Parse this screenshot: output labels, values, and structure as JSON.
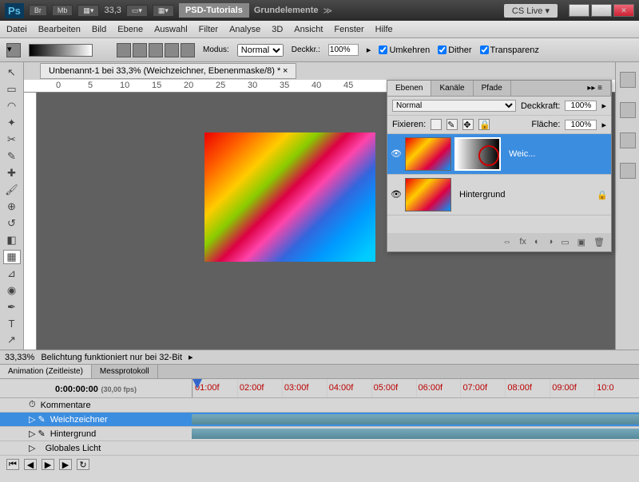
{
  "title": {
    "br": "Br",
    "mb": "Mb",
    "zoom": "33,3",
    "tag": "PSD-Tutorials",
    "sub": "Grundelemente",
    "cslive": "CS Live"
  },
  "menu": [
    "Datei",
    "Bearbeiten",
    "Bild",
    "Ebene",
    "Auswahl",
    "Filter",
    "Analyse",
    "3D",
    "Ansicht",
    "Fenster",
    "Hilfe"
  ],
  "options": {
    "modus": "Modus:",
    "modus_val": "Normal",
    "deck": "Deckkr.:",
    "deck_val": "100%",
    "umk": "Umkehren",
    "dit": "Dither",
    "trans": "Transparenz"
  },
  "doc": {
    "tab": "Unbenannt-1 bei 33,3% (Weichzeichner, Ebenenmaske/8) *"
  },
  "ruler": [
    "0",
    "5",
    "10",
    "15",
    "20",
    "25",
    "30",
    "35",
    "40",
    "45"
  ],
  "layers": {
    "tabs": [
      "Ebenen",
      "Kanäle",
      "Pfade"
    ],
    "blend": "Normal",
    "opacity_lbl": "Deckkraft:",
    "opacity": "100%",
    "fix": "Fixieren:",
    "fill_lbl": "Fläche:",
    "fill": "100%",
    "items": [
      {
        "name": "Weic..."
      },
      {
        "name": "Hintergrund"
      }
    ]
  },
  "status": {
    "zoom": "33,33%",
    "msg": "Belichtung funktioniert nur bei 32-Bit"
  },
  "anim": {
    "tabs": [
      "Animation (Zeitleiste)",
      "Messprotokoll"
    ],
    "tc": "0:00:00:00",
    "fps": "(30,00 fps)",
    "ticks": [
      "01:00f",
      "02:00f",
      "03:00f",
      "04:00f",
      "05:00f",
      "06:00f",
      "07:00f",
      "08:00f",
      "09:00f",
      "10:0"
    ],
    "tracks": [
      "Kommentare",
      "Weichzeichner",
      "Hintergrund",
      "Globales Licht"
    ]
  }
}
